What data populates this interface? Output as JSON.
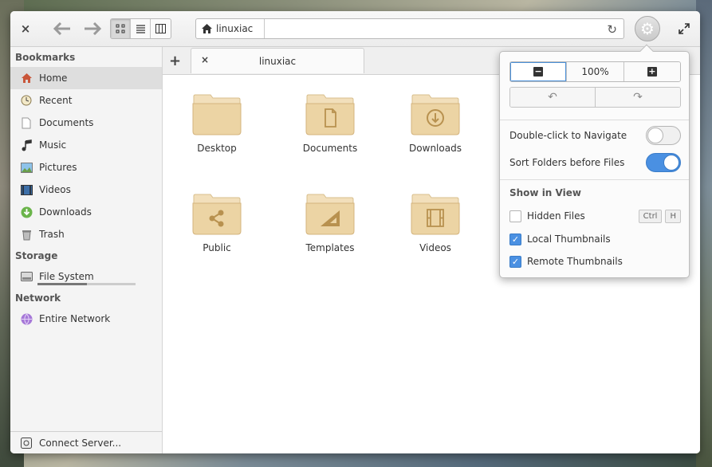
{
  "window": {
    "title": "linuxiac"
  },
  "headerbar": {
    "close_glyph": "×",
    "back_glyph": "←",
    "forward_glyph": "→",
    "view_modes": [
      "grid-view-icon",
      "list-view-icon",
      "column-view-icon"
    ],
    "active_view": "grid",
    "path": "linuxiac",
    "reload_glyph": "↻",
    "gear_glyph": "⚙",
    "maximize_glyph": "⤢"
  },
  "sidebar": {
    "bookmarks_header": "Bookmarks",
    "bookmarks": [
      {
        "label": "Home",
        "icon": "home-icon"
      },
      {
        "label": "Recent",
        "icon": "clock-icon"
      },
      {
        "label": "Documents",
        "icon": "document-icon"
      },
      {
        "label": "Music",
        "icon": "music-icon"
      },
      {
        "label": "Pictures",
        "icon": "picture-icon"
      },
      {
        "label": "Videos",
        "icon": "video-icon"
      },
      {
        "label": "Downloads",
        "icon": "download-icon"
      },
      {
        "label": "Trash",
        "icon": "trash-icon"
      }
    ],
    "storage_header": "Storage",
    "storage": [
      {
        "label": "File System",
        "icon": "drive-icon",
        "usage_fraction": 0.5
      }
    ],
    "network_header": "Network",
    "network": [
      {
        "label": "Entire Network",
        "icon": "network-icon"
      }
    ],
    "footer_label": "Connect Server..."
  },
  "tabs": {
    "new_tab_glyph": "+",
    "close_glyph": "×",
    "items": [
      {
        "label": "linuxiac"
      }
    ]
  },
  "folders": [
    {
      "label": "Desktop",
      "emblem": "none"
    },
    {
      "label": "Documents",
      "emblem": "document"
    },
    {
      "label": "Downloads",
      "emblem": "download"
    },
    {
      "label": "Public",
      "emblem": "share"
    },
    {
      "label": "Templates",
      "emblem": "template"
    },
    {
      "label": "Videos",
      "emblem": "film"
    }
  ],
  "popover": {
    "zoom_out_glyph": "−",
    "zoom_level": "100%",
    "zoom_in_glyph": "+",
    "undo_glyph": "↶",
    "redo_glyph": "↷",
    "double_click_label": "Double-click to Navigate",
    "double_click_on": false,
    "sort_folders_label": "Sort Folders before Files",
    "sort_folders_on": true,
    "show_in_view_header": "Show in View",
    "hidden_files_label": "Hidden Files",
    "hidden_files_checked": false,
    "hidden_files_shortcut": [
      "Ctrl",
      "H"
    ],
    "local_thumbnails_label": "Local Thumbnails",
    "local_thumbnails_checked": true,
    "remote_thumbnails_label": "Remote Thumbnails",
    "remote_thumbnails_checked": true,
    "check_glyph": "✓"
  },
  "colors": {
    "accent": "#4a90e2",
    "folder_fill": "#e9cfa0",
    "folder_tab": "#f1dcb4",
    "emblem": "#b8914f"
  }
}
